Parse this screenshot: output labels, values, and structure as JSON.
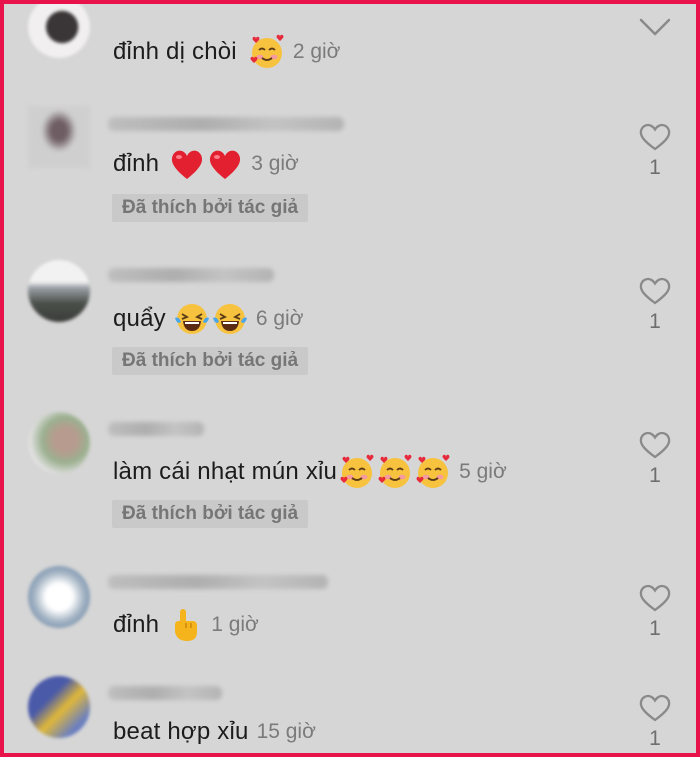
{
  "comments": [
    {
      "text": "đỉnh dị chòi",
      "emojis": [
        "smiling-hearts-icon"
      ],
      "time": "2 giờ",
      "liked_by_author": false,
      "like_count": ""
    },
    {
      "text": "đỉnh",
      "emojis": [
        "red-heart-icon",
        "red-heart-icon"
      ],
      "time": "3 giờ",
      "liked_by_author": true,
      "like_count": "1"
    },
    {
      "text": "quẩy",
      "emojis": [
        "laughing-tears-icon",
        "laughing-tears-icon"
      ],
      "time": "6 giờ",
      "liked_by_author": true,
      "like_count": "1"
    },
    {
      "text": "làm cái nhạt mún xỉu",
      "emojis": [
        "smiling-hearts-icon",
        "smiling-hearts-icon",
        "smiling-hearts-icon"
      ],
      "time": "5 giờ",
      "liked_by_author": true,
      "like_count": "1"
    },
    {
      "text": "đỉnh",
      "emojis": [
        "pointing-hand-icon"
      ],
      "time": "1 giờ",
      "liked_by_author": false,
      "like_count": "1"
    },
    {
      "text": "beat hợp xỉu",
      "emojis": [],
      "time": "15 giờ",
      "liked_by_author": false,
      "like_count": "1"
    }
  ],
  "liked_by_author_label": "Đã thích bởi tác giả",
  "colors": {
    "background": "#d6d6d6",
    "frame": "#e8134a",
    "text": "#1c1c1c",
    "muted": "#7b7b7b",
    "tag_bg": "#c9c9c9"
  }
}
